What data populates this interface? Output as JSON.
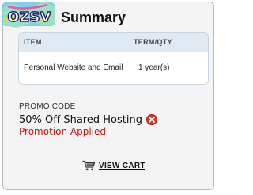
{
  "summary": {
    "title": "Summary",
    "table": {
      "columns": [
        "ITEM",
        "TERM/QTY"
      ],
      "rows": [
        {
          "item": "Personal Website and Email",
          "term": "1 year(s)"
        }
      ]
    }
  },
  "promo": {
    "label": "PROMO CODE",
    "code": "50% Off Shared Hosting",
    "status": "Promotion Applied",
    "status_color": "#cc1111"
  },
  "actions": {
    "view_cart_label": "VIEW CART"
  },
  "logo": {
    "text": "ozsv"
  }
}
